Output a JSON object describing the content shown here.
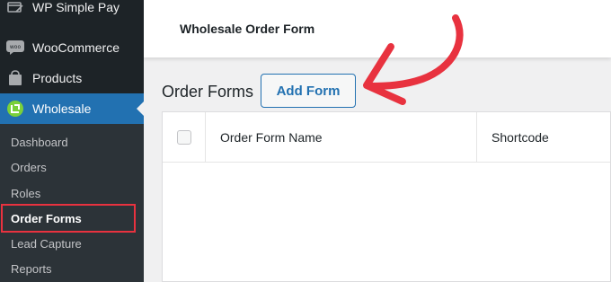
{
  "sidebar": {
    "menu": [
      {
        "label": "WP Simple Pay",
        "icon": "wp-simple-pay-icon"
      },
      {
        "label": "WooCommerce",
        "icon": "woocommerce-icon"
      },
      {
        "label": "Products",
        "icon": "products-icon"
      },
      {
        "label": "Wholesale",
        "icon": "wholesale-icon",
        "active": true
      }
    ],
    "submenu": [
      {
        "label": "Dashboard"
      },
      {
        "label": "Orders"
      },
      {
        "label": "Roles"
      },
      {
        "label": "Order Forms",
        "current": true
      },
      {
        "label": "Lead Capture"
      },
      {
        "label": "Reports"
      }
    ]
  },
  "topbar": {
    "title": "Wholesale Order Form"
  },
  "page": {
    "heading": "Order Forms",
    "add_button": "Add Form"
  },
  "table": {
    "columns": [
      "Order Form Name",
      "Shortcode"
    ]
  },
  "colors": {
    "sidebar_bg": "#1d2327",
    "active_menu": "#2271b1",
    "annotation_red": "#e8323f"
  }
}
